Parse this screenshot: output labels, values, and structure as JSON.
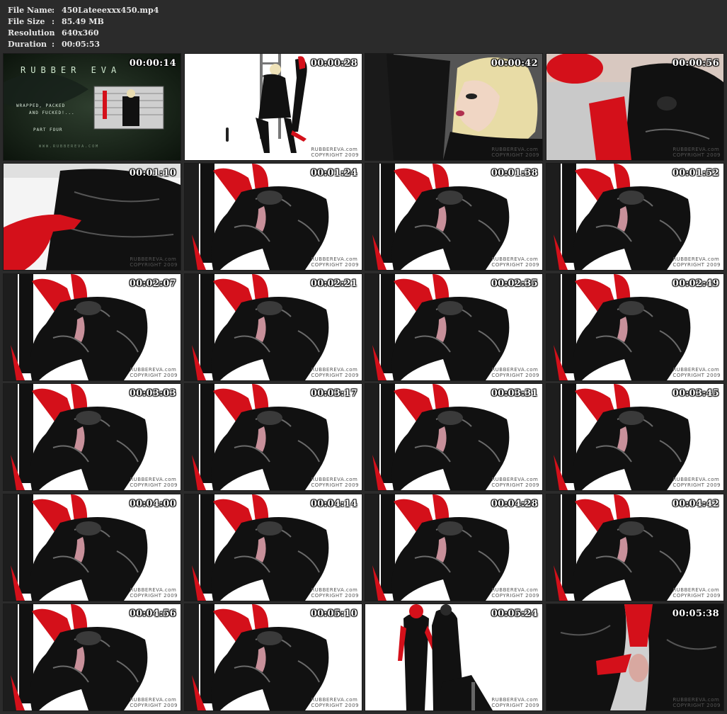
{
  "info": {
    "rows": [
      {
        "label": "File Name",
        "sep": ":",
        "value": "450Lateeexxx450.mp4"
      },
      {
        "label": "File Size",
        "sep": ":",
        "value": "85.49 MB"
      },
      {
        "label": "Resolution",
        "sep": ":",
        "value": "640x360"
      },
      {
        "label": "Duration",
        "sep": ":",
        "value": "00:05:53"
      }
    ]
  },
  "thumbnails": [
    {
      "time": "00:00:14",
      "scene": "title"
    },
    {
      "time": "00:00:28",
      "scene": "ladder"
    },
    {
      "time": "00:00:42",
      "scene": "portrait"
    },
    {
      "time": "00:00:56",
      "scene": "closeup"
    },
    {
      "time": "00:01:10",
      "scene": "glove"
    },
    {
      "time": "00:01:24",
      "scene": "wrapped"
    },
    {
      "time": "00:01:38",
      "scene": "wrapped"
    },
    {
      "time": "00:01:52",
      "scene": "wrapped"
    },
    {
      "time": "00:02:07",
      "scene": "wrapped"
    },
    {
      "time": "00:02:21",
      "scene": "wrapped"
    },
    {
      "time": "00:02:35",
      "scene": "wrapped"
    },
    {
      "time": "00:02:49",
      "scene": "wrapped"
    },
    {
      "time": "00:03:03",
      "scene": "wrapped"
    },
    {
      "time": "00:03:17",
      "scene": "wrapped"
    },
    {
      "time": "00:03:31",
      "scene": "wrapped"
    },
    {
      "time": "00:03:45",
      "scene": "wrapped"
    },
    {
      "time": "00:04:00",
      "scene": "wrapped"
    },
    {
      "time": "00:04:14",
      "scene": "wrapped"
    },
    {
      "time": "00:04:28",
      "scene": "wrapped"
    },
    {
      "time": "00:04:42",
      "scene": "wrapped"
    },
    {
      "time": "00:04:56",
      "scene": "wrapped"
    },
    {
      "time": "00:05:10",
      "scene": "wrapped"
    },
    {
      "time": "00:05:24",
      "scene": "standing"
    },
    {
      "time": "00:05:38",
      "scene": "closeup2"
    }
  ],
  "title_card": {
    "brand": "RUBBER EVA",
    "tagline_lines": [
      "WRAPPED, PACKED",
      "AND FUCKED!..."
    ],
    "part": "PART FOUR",
    "url": "WWW.RUBBEREVA.COM"
  },
  "watermark": {
    "brand": "RUBBEREVA.com",
    "copyright": "COPYRIGHT 2009"
  },
  "colors": {
    "background": "#2b2b2b",
    "latex_red": "#d4101a",
    "latex_black": "#111111",
    "title_green": "#1c2a1c"
  }
}
